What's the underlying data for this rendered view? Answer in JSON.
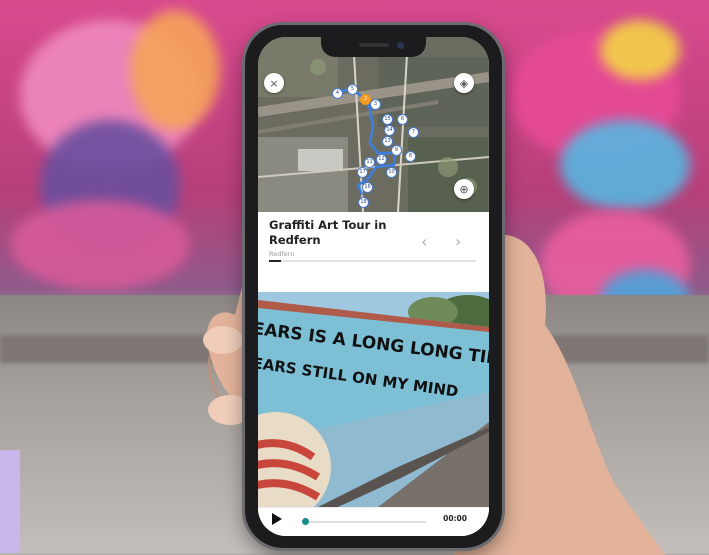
{
  "tour": {
    "title": "Graffiti Art Tour in Redfern",
    "subtitle": "Redfern",
    "progress_fraction": 0.06,
    "prev_arrow": "‹",
    "next_arrow": "›"
  },
  "map": {
    "close_symbol": "×",
    "layers_symbol": "◈",
    "locate_symbol": "⊕",
    "stops": [
      "1",
      "2",
      "3",
      "4",
      "5",
      "6",
      "7",
      "8",
      "9",
      "10",
      "11",
      "12",
      "13",
      "14",
      "15",
      "16",
      "17",
      "18"
    ]
  },
  "mural": {
    "line1": "EARS IS A LONG LONG TIME",
    "line2": "EARS STILL ON MY MIND"
  },
  "player": {
    "time": "00:00",
    "position_fraction": 0.0
  },
  "colors": {
    "route": "#3d7fe0",
    "accent": "#1a8a8a",
    "current_stop": "#f39c1f"
  }
}
